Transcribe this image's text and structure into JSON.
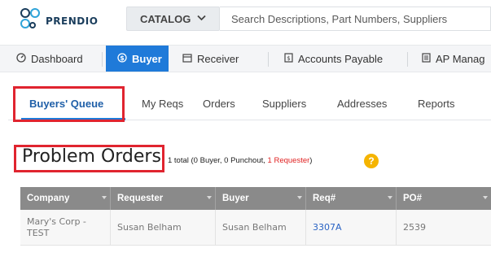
{
  "header": {
    "logo_text": "PRENDIO",
    "catalog_label": "CATALOG",
    "search_placeholder": "Search Descriptions, Part Numbers, Suppliers"
  },
  "modules": [
    {
      "label": "Dashboard",
      "icon": "dashboard-icon",
      "active": false
    },
    {
      "label": "Buyer",
      "icon": "dollar-icon",
      "active": true
    },
    {
      "label": "Receiver",
      "icon": "calendar-icon",
      "active": false
    },
    {
      "label": "Accounts Payable",
      "icon": "dollar-doc-icon",
      "active": false
    },
    {
      "label": "AP Manag",
      "icon": "doc-icon",
      "active": false
    }
  ],
  "subtabs": [
    {
      "label": "Buyers' Queue",
      "active": true
    },
    {
      "label": "My Reqs",
      "active": false
    },
    {
      "label": "Orders",
      "active": false
    },
    {
      "label": "Suppliers",
      "active": false
    },
    {
      "label": "Addresses",
      "active": false
    },
    {
      "label": "Reports",
      "active": false
    }
  ],
  "page": {
    "title": "Problem Orders",
    "summary_prefix": "1 total (0 Buyer, 0 Punchout, ",
    "summary_requester": "1 Requester",
    "summary_suffix": ")",
    "help_symbol": "?"
  },
  "table": {
    "columns": [
      "Company",
      "Requester",
      "Buyer",
      "Req#",
      "PO#"
    ],
    "rows": [
      {
        "company_line1": "Mary's Corp -",
        "company_line2": "TEST",
        "requester": "Susan Belham",
        "buyer": "Susan Belham",
        "req": "3307A",
        "po": "2539"
      }
    ]
  },
  "colors": {
    "accent": "#1f7ad9",
    "highlight": "#e0242f",
    "header_gray": "#8a8a8a"
  }
}
